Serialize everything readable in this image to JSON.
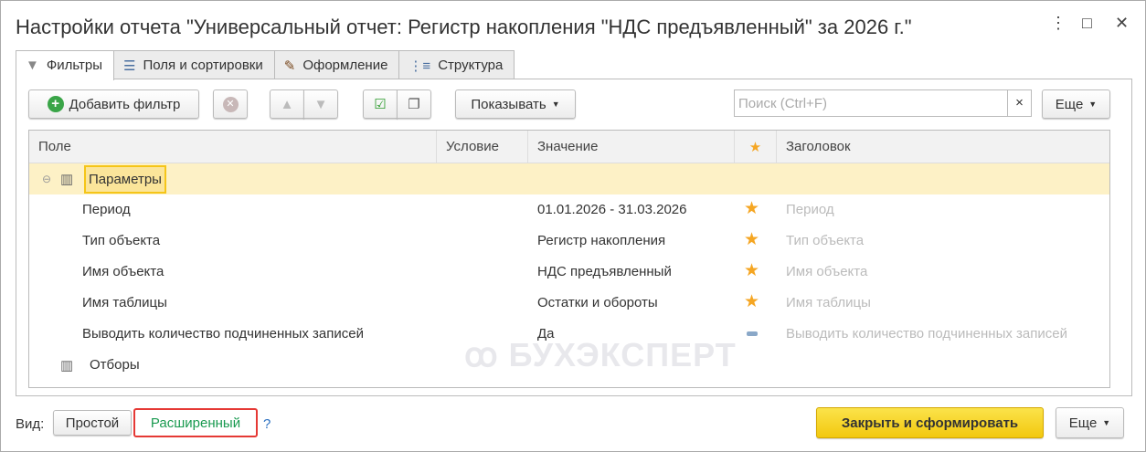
{
  "title": "Настройки отчета \"Универсальный отчет: Регистр накопления \"НДС предъявленный\" за 2026 г.\"",
  "window": {
    "more": "⋮",
    "maximize": "□",
    "close": "✕"
  },
  "tabs": [
    {
      "label": "Фильтры",
      "icon": "funnel-icon"
    },
    {
      "label": "Поля и сортировки",
      "icon": "sort-fields-icon"
    },
    {
      "label": "Оформление",
      "icon": "brush-icon"
    },
    {
      "label": "Структура",
      "icon": "structure-icon"
    }
  ],
  "toolbar": {
    "add_filter": "Добавить фильтр",
    "show": "Показывать",
    "search_placeholder": "Поиск (Ctrl+F)",
    "clear": "×",
    "more": "Еще"
  },
  "columns": [
    "Поле",
    "Условие",
    "Значение",
    "★",
    "Заголовок"
  ],
  "group": "Параметры",
  "rows": [
    {
      "field": "Период",
      "value": "01.01.2026 - 31.03.2026",
      "use": "star",
      "title": "Период"
    },
    {
      "field": "Тип объекта",
      "value": "Регистр накопления",
      "use": "star",
      "title": "Тип объекта"
    },
    {
      "field": "Имя объекта",
      "value": "НДС предъявленный",
      "use": "star",
      "title": "Имя объекта"
    },
    {
      "field": "Имя таблицы",
      "value": "Остатки и обороты",
      "use": "star",
      "title": "Имя таблицы"
    },
    {
      "field": "Выводить количество подчиненных записей",
      "value": "Да",
      "use": "dash",
      "title": "Выводить количество подчиненных записей"
    }
  ],
  "filters_group": "Отборы",
  "watermark": "БУХЭКСПЕРТ",
  "footer": {
    "view_label": "Вид:",
    "simple": "Простой",
    "extended": "Расширенный",
    "help": "?",
    "generate": "Закрыть и сформировать",
    "more": "Еще"
  }
}
